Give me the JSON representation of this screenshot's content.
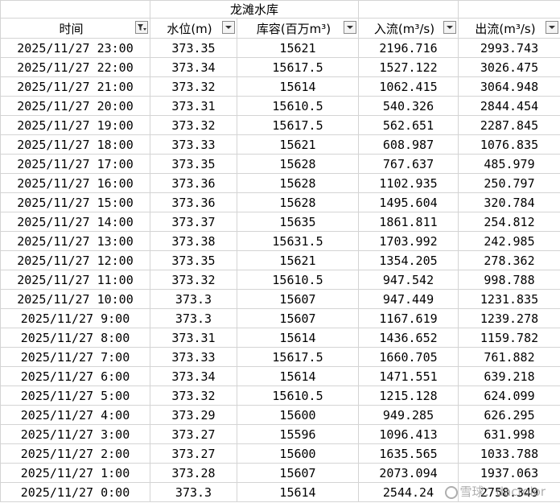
{
  "sheet": {
    "title": "龙滩水库",
    "headers": [
      "时间",
      "水位(m)",
      "库容(百万m³)",
      "入流(m³/s)",
      "出流(m³/s)"
    ],
    "rows": [
      [
        "2025/11/27 23:00",
        "373.35",
        "15621",
        "2196.716",
        "2993.743"
      ],
      [
        "2025/11/27 22:00",
        "373.34",
        "15617.5",
        "1527.122",
        "3026.475"
      ],
      [
        "2025/11/27 21:00",
        "373.32",
        "15614",
        "1062.415",
        "3064.948"
      ],
      [
        "2025/11/27 20:00",
        "373.31",
        "15610.5",
        "540.326",
        "2844.454"
      ],
      [
        "2025/11/27 19:00",
        "373.32",
        "15617.5",
        "562.651",
        "2287.845"
      ],
      [
        "2025/11/27 18:00",
        "373.33",
        "15621",
        "608.987",
        "1076.835"
      ],
      [
        "2025/11/27 17:00",
        "373.35",
        "15628",
        "767.637",
        "485.979"
      ],
      [
        "2025/11/27 16:00",
        "373.36",
        "15628",
        "1102.935",
        "250.797"
      ],
      [
        "2025/11/27 15:00",
        "373.36",
        "15628",
        "1495.604",
        "320.784"
      ],
      [
        "2025/11/27 14:00",
        "373.37",
        "15635",
        "1861.811",
        "254.812"
      ],
      [
        "2025/11/27 13:00",
        "373.38",
        "15631.5",
        "1703.992",
        "242.985"
      ],
      [
        "2025/11/27 12:00",
        "373.35",
        "15621",
        "1354.205",
        "278.362"
      ],
      [
        "2025/11/27 11:00",
        "373.32",
        "15610.5",
        "947.542",
        "998.788"
      ],
      [
        "2025/11/27 10:00",
        "373.3",
        "15607",
        "947.449",
        "1231.835"
      ],
      [
        "2025/11/27 9:00",
        "373.3",
        "15607",
        "1167.619",
        "1239.278"
      ],
      [
        "2025/11/27 8:00",
        "373.31",
        "15614",
        "1436.652",
        "1159.782"
      ],
      [
        "2025/11/27 7:00",
        "373.33",
        "15617.5",
        "1660.705",
        "761.882"
      ],
      [
        "2025/11/27 6:00",
        "373.34",
        "15614",
        "1471.551",
        "639.218"
      ],
      [
        "2025/11/27 5:00",
        "373.32",
        "15610.5",
        "1215.128",
        "624.099"
      ],
      [
        "2025/11/27 4:00",
        "373.29",
        "15600",
        "949.285",
        "626.295"
      ],
      [
        "2025/11/27 3:00",
        "373.27",
        "15596",
        "1096.413",
        "631.998"
      ],
      [
        "2025/11/27 2:00",
        "373.27",
        "15600",
        "1635.565",
        "1033.788"
      ],
      [
        "2025/11/27 1:00",
        "373.28",
        "15607",
        "2073.094",
        "1937.063"
      ],
      [
        "2025/11/27 0:00",
        "373.3",
        "15614",
        "2544.24",
        "2758.349"
      ]
    ],
    "filter_active_column": 0
  },
  "watermark": {
    "text": "雪球：dacrolor",
    "icon": "xueqiu-logo-icon"
  }
}
